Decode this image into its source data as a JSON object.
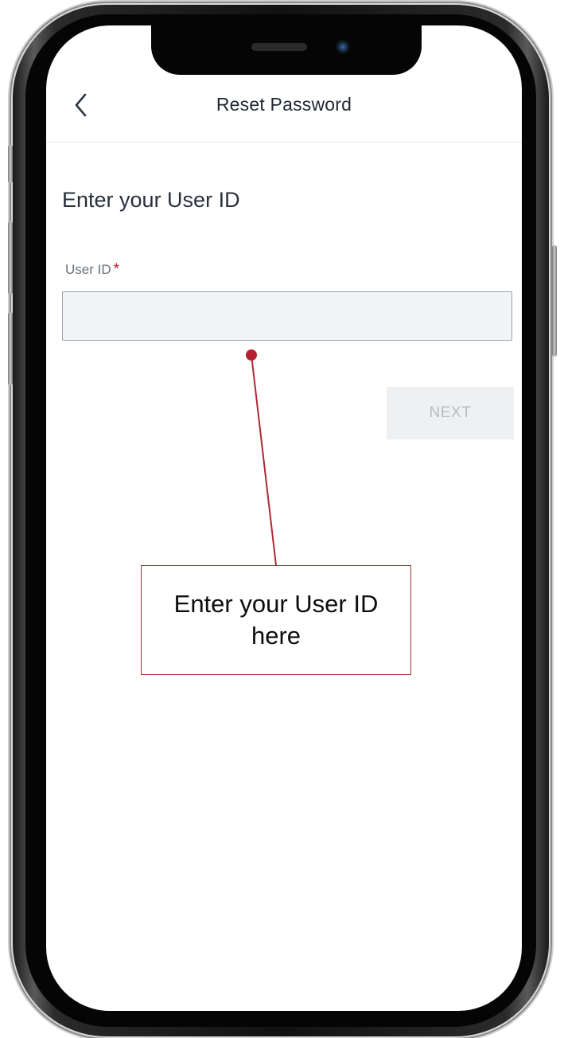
{
  "nav": {
    "title": "Reset Password",
    "back_icon": "chevron-left-icon"
  },
  "form": {
    "heading": "Enter your User ID",
    "user_id_label": "User ID",
    "required_marker": "*",
    "user_id_value": "",
    "user_id_placeholder": "",
    "next_label": "NEXT"
  },
  "annotation": {
    "callout_text": "Enter your User ID here"
  },
  "colors": {
    "accent_red": "#b8202e",
    "callout_border": "#a92a35",
    "title_text": "#1f2733",
    "input_bg": "#f2f4f6",
    "disabled_button_bg": "#eef0f2",
    "disabled_button_text": "#b9bcc0"
  }
}
